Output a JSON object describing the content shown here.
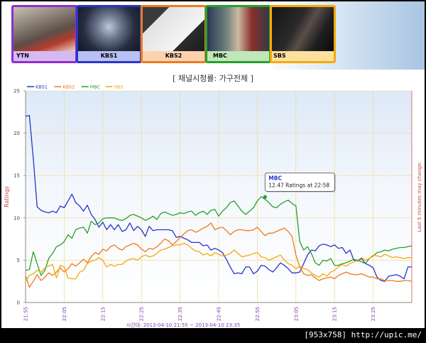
{
  "channels": [
    {
      "name": "YTN",
      "color": "#8e2fd2",
      "label_bg": "#d7b9f2"
    },
    {
      "name": "KBS1",
      "color": "#2836c9",
      "label_bg": "#b9c0f3"
    },
    {
      "name": "KBS2",
      "color": "#f07a1d",
      "label_bg": "#fbd3b0"
    },
    {
      "name": "MBC",
      "color": "#25a12c",
      "label_bg": "#bfe7b9"
    },
    {
      "name": "SBS",
      "color": "#f6a90a",
      "label_bg": "#fde0a0"
    }
  ],
  "footer_credit": "[953x758] http://upic.me/",
  "chart_data": {
    "type": "line",
    "title": "[ 채널시청률: 가구전체 ]",
    "ylabel": "Ratings",
    "right_label": "Last 5 minutes may change.",
    "xlabel": "시간대: 2013-04-10 21:55 ~ 2013-04-10 23:35",
    "ylim": [
      0,
      25
    ],
    "yticks": [
      0,
      5,
      10,
      15,
      20,
      25
    ],
    "xlim": [
      0,
      100
    ],
    "xticks": [
      {
        "m": 0,
        "label": "21:55"
      },
      {
        "m": 10,
        "label": "22:05"
      },
      {
        "m": 20,
        "label": "22:15"
      },
      {
        "m": 30,
        "label": "22:25"
      },
      {
        "m": 40,
        "label": "22:35"
      },
      {
        "m": 50,
        "label": "22:45"
      },
      {
        "m": 60,
        "label": "22:55"
      },
      {
        "m": 70,
        "label": "23:05"
      },
      {
        "m": 80,
        "label": "23:15"
      },
      {
        "m": 90,
        "label": "23:25"
      }
    ],
    "grid": true,
    "legend": "top-left",
    "series": [
      {
        "name": "KBS1",
        "color": "#2836c9",
        "values": [
          22.0,
          22.1,
          17.0,
          11.3,
          10.9,
          10.7,
          10.6,
          10.8,
          10.6,
          11.4,
          11.2,
          12.0,
          12.8,
          11.8,
          11.4,
          10.8,
          11.5,
          10.4,
          9.8,
          8.9,
          9.5,
          8.6,
          9.2,
          8.6,
          9.2,
          8.4,
          8.6,
          9.4,
          8.5,
          9.0,
          8.6,
          7.8,
          9.0,
          8.5,
          8.6,
          8.6,
          8.6,
          8.6,
          8.5,
          7.7,
          7.8,
          7.6,
          7.4,
          7.1,
          7.1,
          7.1,
          6.7,
          6.8,
          6.2,
          6.4,
          6.2,
          5.9,
          5.1,
          4.2,
          3.4,
          3.5,
          3.4,
          4.2,
          4.2,
          3.4,
          3.7,
          4.4,
          4.3,
          3.9,
          3.6,
          4.1,
          4.7,
          4.4,
          4.0,
          3.5,
          3.5,
          3.6,
          4.6,
          5.6,
          6.2,
          6.1,
          6.7,
          6.9,
          6.8,
          6.6,
          6.8,
          6.4,
          6.5,
          5.8,
          6.2,
          5.0,
          4.9,
          5.2,
          4.6,
          4.4,
          4.1,
          3.0,
          2.6,
          2.5,
          3.1,
          3.2,
          3.3,
          3.1,
          2.8,
          4.2,
          4.2
        ]
      },
      {
        "name": "KBS2",
        "color": "#f07a1d",
        "values": [
          3.2,
          1.8,
          2.5,
          3.3,
          2.6,
          3.0,
          3.5,
          3.2,
          3.6,
          4.1,
          3.6,
          4.0,
          4.6,
          4.3,
          4.7,
          5.1,
          4.7,
          5.4,
          5.9,
          5.7,
          6.3,
          6.1,
          6.6,
          6.8,
          6.4,
          6.2,
          6.6,
          6.8,
          7.0,
          6.8,
          6.3,
          6.0,
          6.4,
          6.3,
          6.6,
          7.0,
          7.5,
          7.3,
          6.8,
          7.2,
          7.7,
          8.1,
          8.5,
          8.6,
          8.3,
          8.5,
          8.8,
          9.0,
          9.4,
          8.6,
          8.8,
          8.9,
          8.5,
          8.0,
          8.4,
          8.6,
          8.6,
          8.5,
          8.5,
          8.6,
          8.9,
          8.4,
          7.9,
          8.2,
          8.2,
          8.4,
          8.6,
          8.8,
          8.4,
          7.8,
          5.6,
          4.2,
          3.4,
          3.2,
          3.3,
          2.9,
          2.6,
          2.8,
          2.9,
          3.0,
          2.8,
          3.2,
          3.4,
          3.6,
          3.4,
          3.3,
          3.3,
          3.4,
          3.2,
          3.0,
          3.0,
          2.8,
          2.8,
          2.6,
          2.6,
          2.6,
          2.5,
          2.5,
          2.6,
          2.6,
          2.5
        ]
      },
      {
        "name": "MBC",
        "color": "#25a12c",
        "values": [
          3.8,
          3.9,
          6.0,
          4.6,
          3.2,
          3.8,
          5.2,
          5.8,
          6.6,
          6.8,
          7.2,
          8.0,
          7.6,
          8.6,
          8.8,
          8.9,
          8.2,
          9.6,
          9.2,
          9.4,
          9.9,
          10.0,
          10.0,
          10.0,
          9.8,
          9.7,
          9.9,
          10.3,
          10.4,
          10.2,
          10.0,
          9.7,
          9.9,
          10.2,
          9.8,
          10.5,
          10.7,
          10.5,
          10.3,
          10.4,
          10.6,
          10.5,
          10.7,
          10.8,
          10.3,
          10.6,
          10.8,
          10.4,
          10.9,
          11.0,
          10.2,
          10.8,
          11.2,
          11.8,
          12.0,
          11.4,
          10.8,
          10.4,
          10.8,
          11.2,
          12.0,
          12.5,
          12.2,
          11.8,
          11.3,
          11.2,
          11.6,
          11.9,
          12.1,
          11.7,
          11.4,
          7.2,
          6.2,
          6.6,
          5.8,
          4.7,
          4.4,
          5.0,
          4.9,
          5.2,
          4.4,
          4.4,
          4.6,
          4.7,
          4.9,
          5.1,
          5.0,
          4.8,
          4.6,
          5.2,
          5.5,
          5.9,
          6.0,
          6.2,
          6.1,
          6.3,
          6.4,
          6.5,
          6.5,
          6.6,
          6.7
        ]
      },
      {
        "name": "SBS",
        "color": "#f6a90a",
        "values": [
          2.5,
          3.2,
          3.4,
          3.8,
          3.6,
          4.1,
          4.3,
          4.5,
          2.9,
          4.4,
          4.2,
          2.9,
          2.8,
          2.8,
          3.6,
          3.8,
          4.6,
          4.9,
          5.0,
          5.3,
          5.0,
          4.2,
          4.5,
          4.3,
          4.5,
          4.5,
          4.9,
          5.1,
          5.2,
          5.0,
          5.4,
          5.6,
          5.4,
          5.5,
          5.8,
          6.2,
          6.3,
          6.5,
          6.7,
          6.8,
          6.8,
          7.0,
          6.8,
          6.4,
          6.1,
          6.0,
          5.6,
          5.8,
          5.5,
          5.9,
          5.7,
          5.5,
          5.6,
          5.8,
          6.2,
          5.8,
          5.4,
          5.5,
          5.6,
          5.8,
          5.9,
          5.4,
          5.3,
          5.0,
          5.2,
          5.4,
          5.6,
          5.0,
          4.6,
          4.4,
          4.0,
          4.3,
          4.0,
          3.9,
          3.5,
          3.2,
          3.0,
          3.4,
          3.1,
          3.6,
          3.8,
          4.2,
          4.5,
          4.3,
          4.6,
          4.8,
          5.0,
          5.3,
          5.0,
          5.2,
          5.6,
          5.5,
          5.4,
          5.7,
          5.5,
          5.3,
          5.4,
          5.3,
          5.2,
          5.3,
          5.3
        ]
      }
    ],
    "tooltip": {
      "series": "MBC",
      "x": 62,
      "y": 12.47,
      "title": "MBC",
      "text": "12.47 Ratings at 22:58"
    }
  }
}
